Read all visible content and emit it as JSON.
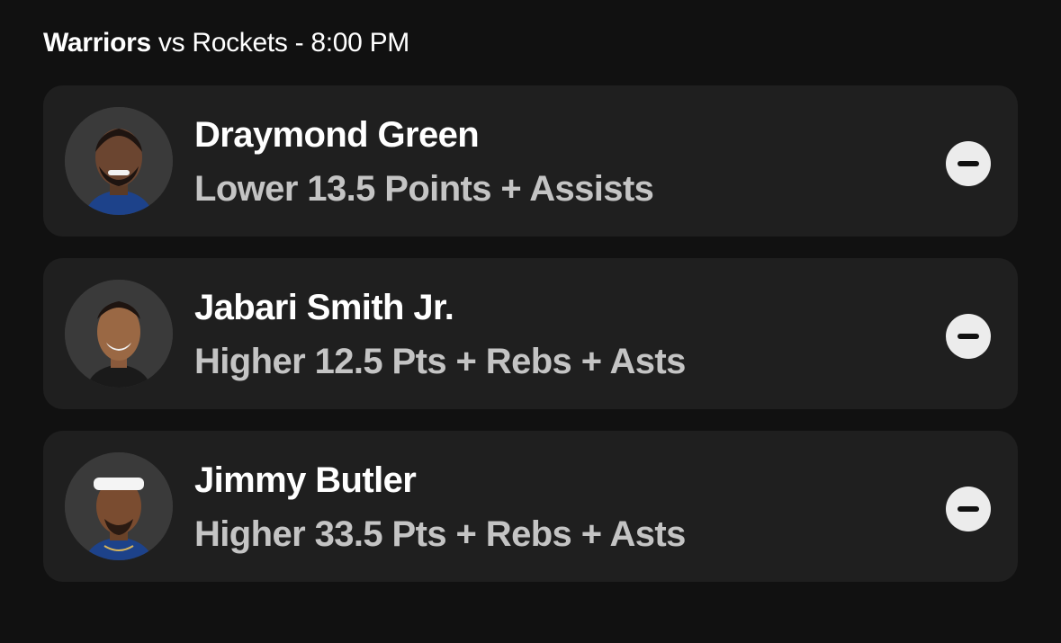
{
  "header": {
    "team_home": "Warriors",
    "matchup_rest": " vs Rockets - 8:00 PM"
  },
  "picks": [
    {
      "player": "Draymond Green",
      "line": "Lower 13.5 Points + Assists",
      "jersey_color": "#1d428a"
    },
    {
      "player": "Jabari Smith Jr.",
      "line": "Higher 12.5 Pts + Rebs + Asts",
      "jersey_color": "#1a1a1a"
    },
    {
      "player": "Jimmy Butler",
      "line": "Higher 33.5 Pts + Rebs + Asts",
      "jersey_color": "#1d428a"
    }
  ],
  "icons": {
    "remove": "minus-circle-icon"
  }
}
